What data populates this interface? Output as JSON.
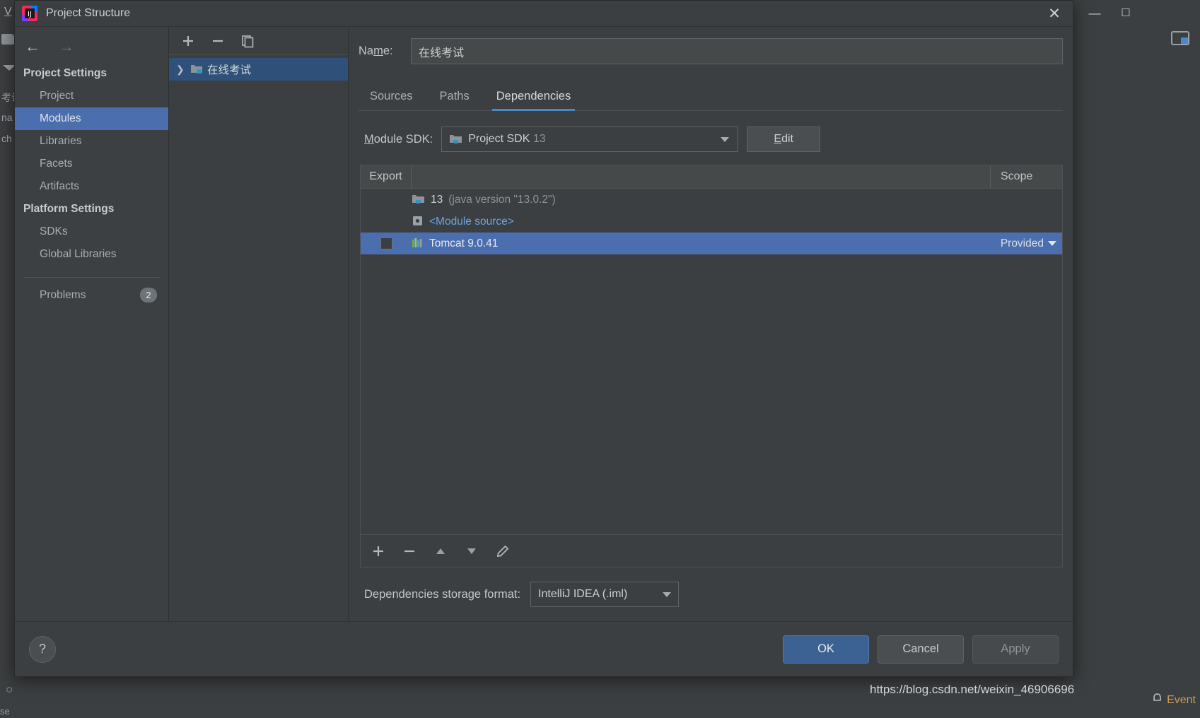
{
  "background": {
    "menu_v": "V",
    "left_texts": [
      "考试",
      "na",
      "ch"
    ],
    "event_log": "Event",
    "search_text": "se",
    "icons": {
      "file": "file-icon",
      "caret": "chevron-down-icon",
      "database": "database-icon",
      "minimize": "minimize-icon",
      "maximize": "maximize-icon",
      "event_bell": "bell-icon"
    }
  },
  "dialog": {
    "title": "Project Structure",
    "app_icon": "intellij-idea-logo",
    "close_icon": "close-icon"
  },
  "nav": {
    "back_icon": "arrow-left-icon",
    "forward_icon": "arrow-right-icon",
    "groups": [
      {
        "label": "Project Settings",
        "items": [
          {
            "label": "Project",
            "selected": false
          },
          {
            "label": "Modules",
            "selected": true
          },
          {
            "label": "Libraries",
            "selected": false
          },
          {
            "label": "Facets",
            "selected": false
          },
          {
            "label": "Artifacts",
            "selected": false
          }
        ]
      },
      {
        "label": "Platform Settings",
        "items": [
          {
            "label": "SDKs",
            "selected": false
          },
          {
            "label": "Global Libraries",
            "selected": false
          }
        ]
      }
    ],
    "problems": {
      "label": "Problems",
      "badge": "2"
    }
  },
  "tree": {
    "toolbar": [
      {
        "name": "add-module-button",
        "glyph": "+"
      },
      {
        "name": "remove-module-button",
        "glyph": "−"
      },
      {
        "name": "copy-module-button",
        "glyph": "copy-icon"
      }
    ],
    "rows": [
      {
        "label": "在线考试",
        "expand_icon": "chevron-right-icon",
        "icon": "module-folder-icon",
        "selected": true
      }
    ]
  },
  "content": {
    "name_label_pre": "Na",
    "name_label_mnemonic": "m",
    "name_label_post": "e:",
    "name_value": "在线考试",
    "name_placeholder": "",
    "tabs": [
      {
        "label": "Sources",
        "active": false
      },
      {
        "label": "Paths",
        "active": false
      },
      {
        "label": "Dependencies",
        "active": true
      }
    ],
    "sdk": {
      "label_mnemonic": "M",
      "label_rest": "odule SDK:",
      "value_main": "Project SDK",
      "value_dim": "13",
      "icon": "jdk-folder-icon",
      "edit_mnemonic": "E",
      "edit_rest": "dit"
    },
    "table": {
      "columns": {
        "export": "Export",
        "middle": "",
        "scope": "Scope"
      },
      "rows": [
        {
          "checkbox": false,
          "checkbox_visible": false,
          "icon": "jdk-folder-icon",
          "text_main": "13",
          "text_dim": "(java version \"13.0.2\")",
          "link": false,
          "scope": "",
          "selected": false
        },
        {
          "checkbox": false,
          "checkbox_visible": false,
          "icon": "module-source-icon",
          "text_main": "<Module source>",
          "text_dim": "",
          "link": true,
          "scope": "",
          "selected": false
        },
        {
          "checkbox": false,
          "checkbox_visible": true,
          "icon": "tomcat-icon",
          "text_main": "Tomcat 9.0.41",
          "text_dim": "",
          "link": false,
          "scope": "Provided",
          "selected": true
        }
      ]
    },
    "dep_toolbar": [
      {
        "name": "add-dependency-button",
        "glyph": "+"
      },
      {
        "name": "remove-dependency-button",
        "glyph": "−"
      },
      {
        "name": "move-up-button",
        "glyph": "triangle-up-icon"
      },
      {
        "name": "move-down-button",
        "glyph": "triangle-down-icon"
      },
      {
        "name": "edit-dependency-button",
        "glyph": "pencil-icon"
      }
    ],
    "storage": {
      "label": "Dependencies storage format:",
      "value": "IntelliJ IDEA (.iml)"
    }
  },
  "footer": {
    "help_glyph": "?",
    "ok": "OK",
    "cancel": "Cancel",
    "apply": "Apply"
  },
  "watermark": "https://blog.csdn.net/weixin_46906696"
}
